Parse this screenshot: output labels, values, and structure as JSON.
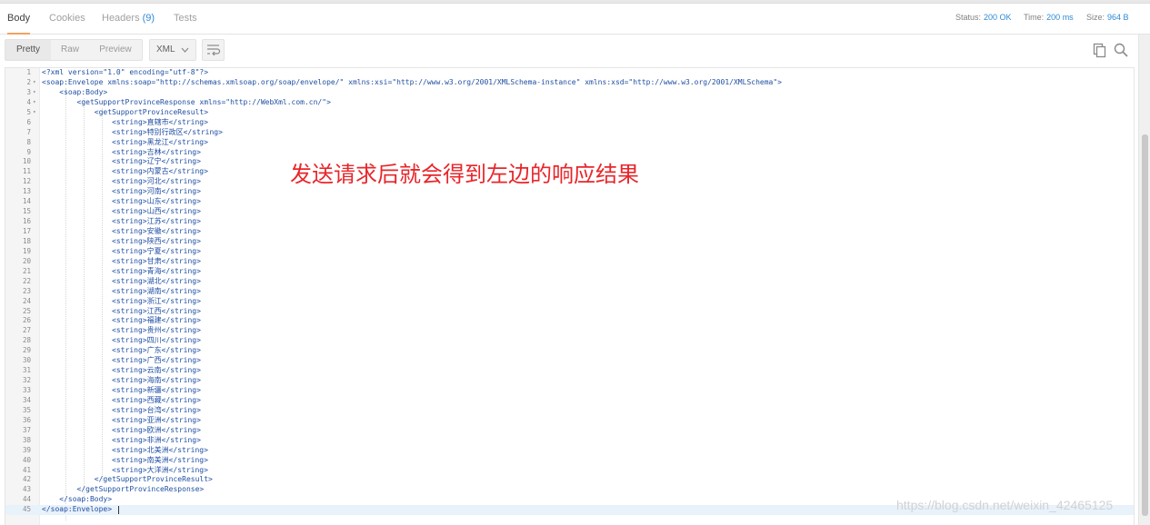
{
  "tabs": [
    {
      "label": "Body"
    },
    {
      "label": "Cookies"
    },
    {
      "label": "Headers",
      "count": "(9)"
    },
    {
      "label": "Tests"
    }
  ],
  "status": {
    "status_label": "Status:",
    "status_value": "200 OK",
    "time_label": "Time:",
    "time_value": "200 ms",
    "size_label": "Size:",
    "size_value": "964 B"
  },
  "view_modes": [
    {
      "label": "Pretty"
    },
    {
      "label": "Raw"
    },
    {
      "label": "Preview"
    }
  ],
  "format": {
    "selected": "XML"
  },
  "icons": {
    "wrap": "wrap-lines-icon",
    "copy": "copy-icon",
    "search": "search-icon",
    "fold": "fold-arrow-icon",
    "dropdown": "chevron-down-icon"
  },
  "colors": {
    "accent": "#2e8ad6",
    "tab_underline": "#f4a261",
    "annotation": "#e8262a",
    "code_tag": "#1f4fa3"
  },
  "editor": {
    "lines": [
      {
        "n": "1",
        "text": "<?xml version=\"1.0\" encoding=\"utf-8\"?>"
      },
      {
        "n": "2",
        "text": "<soap:Envelope xmlns:soap=\"http://schemas.xmlsoap.org/soap/envelope/\" xmlns:xsi=\"http://www.w3.org/2001/XMLSchema-instance\" xmlns:xsd=\"http://www.w3.org/2001/XMLSchema\">"
      },
      {
        "n": "3",
        "text": "    <soap:Body>"
      },
      {
        "n": "4",
        "text": "        <getSupportProvinceResponse xmlns=\"http://WebXml.com.cn/\">"
      },
      {
        "n": "5",
        "text": "            <getSupportProvinceResult>"
      },
      {
        "n": "6",
        "text": "                <string>直辖市</string>"
      },
      {
        "n": "7",
        "text": "                <string>特别行政区</string>"
      },
      {
        "n": "8",
        "text": "                <string>黑龙江</string>"
      },
      {
        "n": "9",
        "text": "                <string>吉林</string>"
      },
      {
        "n": "10",
        "text": "                <string>辽宁</string>"
      },
      {
        "n": "11",
        "text": "                <string>内蒙古</string>"
      },
      {
        "n": "12",
        "text": "                <string>河北</string>"
      },
      {
        "n": "13",
        "text": "                <string>河南</string>"
      },
      {
        "n": "14",
        "text": "                <string>山东</string>"
      },
      {
        "n": "15",
        "text": "                <string>山西</string>"
      },
      {
        "n": "16",
        "text": "                <string>江苏</string>"
      },
      {
        "n": "17",
        "text": "                <string>安徽</string>"
      },
      {
        "n": "18",
        "text": "                <string>陕西</string>"
      },
      {
        "n": "19",
        "text": "                <string>宁夏</string>"
      },
      {
        "n": "20",
        "text": "                <string>甘肃</string>"
      },
      {
        "n": "21",
        "text": "                <string>青海</string>"
      },
      {
        "n": "22",
        "text": "                <string>湖北</string>"
      },
      {
        "n": "23",
        "text": "                <string>湖南</string>"
      },
      {
        "n": "24",
        "text": "                <string>浙江</string>"
      },
      {
        "n": "25",
        "text": "                <string>江西</string>"
      },
      {
        "n": "26",
        "text": "                <string>福建</string>"
      },
      {
        "n": "27",
        "text": "                <string>贵州</string>"
      },
      {
        "n": "28",
        "text": "                <string>四川</string>"
      },
      {
        "n": "29",
        "text": "                <string>广东</string>"
      },
      {
        "n": "30",
        "text": "                <string>广西</string>"
      },
      {
        "n": "31",
        "text": "                <string>云南</string>"
      },
      {
        "n": "32",
        "text": "                <string>海南</string>"
      },
      {
        "n": "33",
        "text": "                <string>新疆</string>"
      },
      {
        "n": "34",
        "text": "                <string>西藏</string>"
      },
      {
        "n": "35",
        "text": "                <string>台湾</string>"
      },
      {
        "n": "36",
        "text": "                <string>亚洲</string>"
      },
      {
        "n": "37",
        "text": "                <string>欧洲</string>"
      },
      {
        "n": "38",
        "text": "                <string>非洲</string>"
      },
      {
        "n": "39",
        "text": "                <string>北美洲</string>"
      },
      {
        "n": "40",
        "text": "                <string>南美洲</string>"
      },
      {
        "n": "41",
        "text": "                <string>大洋洲</string>"
      },
      {
        "n": "42",
        "text": "            </getSupportProvinceResult>"
      },
      {
        "n": "43",
        "text": "        </getSupportProvinceResponse>"
      },
      {
        "n": "44",
        "text": "    </soap:Body>"
      },
      {
        "n": "45",
        "text": "</soap:Envelope>"
      }
    ]
  },
  "annotation": "发送请求后就会得到左边的响应结果",
  "watermark": "https://blog.csdn.net/weixin_42465125"
}
